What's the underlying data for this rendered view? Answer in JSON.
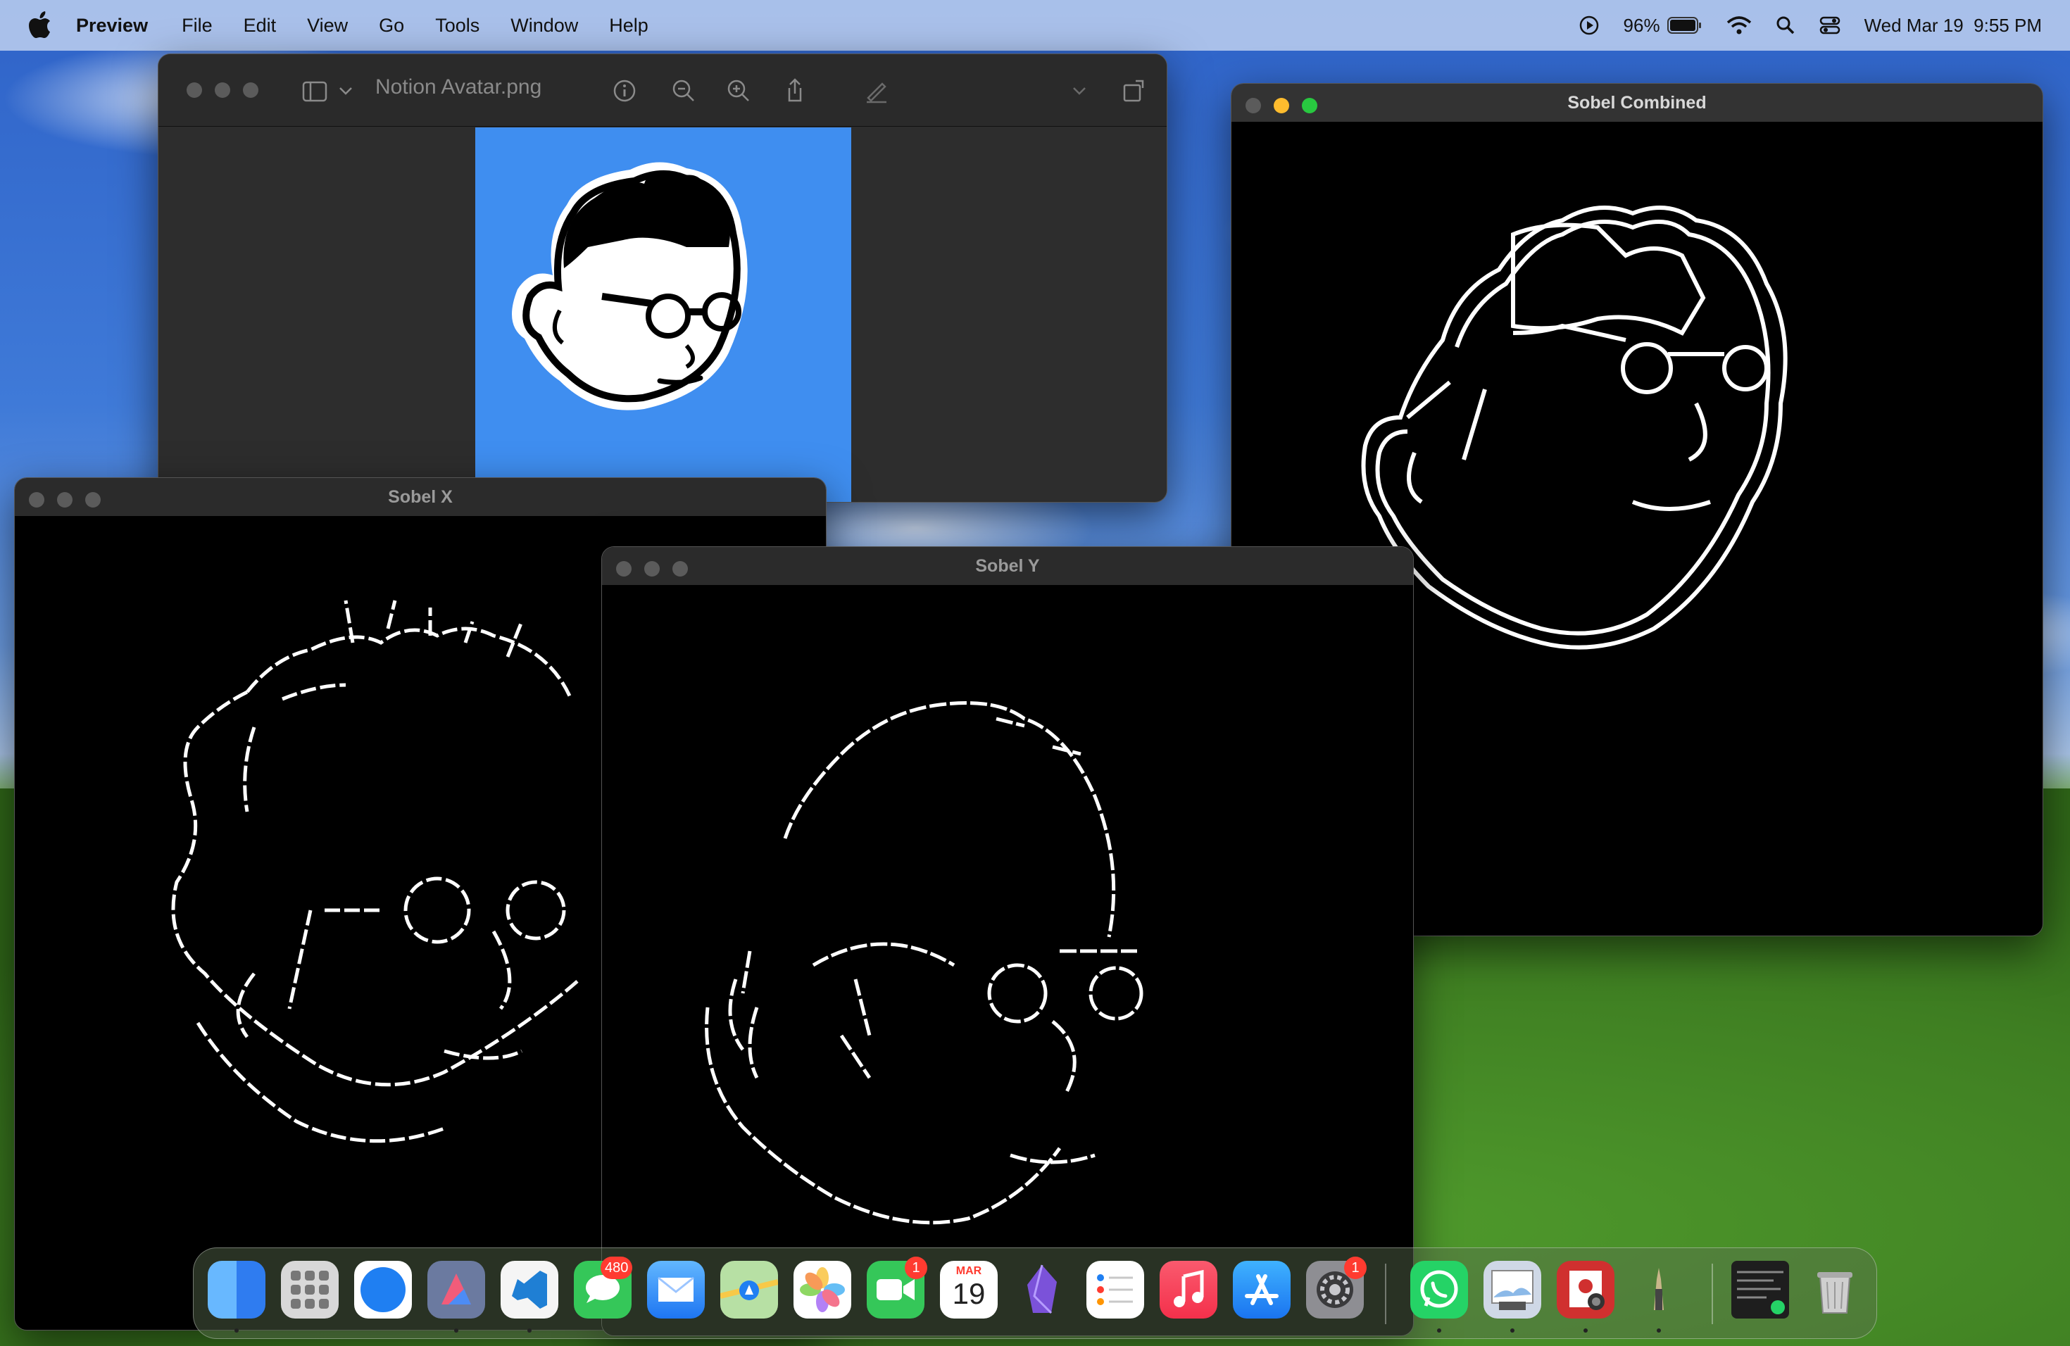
{
  "menubar": {
    "app_name": "Preview",
    "items": [
      "File",
      "Edit",
      "View",
      "Go",
      "Tools",
      "Window",
      "Help"
    ],
    "battery": "96%",
    "datetime": "Wed Mar 19  9:55 PM",
    "icons": [
      "apple-icon",
      "play-icon",
      "battery-icon",
      "wifi-icon",
      "search-icon",
      "control-center-icon"
    ]
  },
  "preview_window": {
    "title": "Notion Avatar.png",
    "toolbar_icons": [
      "sidebar-icon",
      "chevron-down-icon",
      "info-icon",
      "zoom-out-icon",
      "zoom-in-icon",
      "share-icon",
      "markup-pen-icon",
      "chevron-down-icon",
      "rotate-icon",
      "markup-icon",
      "more-icon",
      "search-icon"
    ]
  },
  "windows": {
    "sobel_x": {
      "title": "Sobel X"
    },
    "sobel_y": {
      "title": "Sobel Y"
    },
    "sobel_combined": {
      "title": "Sobel Combined"
    }
  },
  "dock": {
    "apps": [
      {
        "name": "Finder",
        "color": "#3a8ef6"
      },
      {
        "name": "Launchpad",
        "color": "#d8d8d8"
      },
      {
        "name": "Safari",
        "color": "#1f7ff2"
      },
      {
        "name": "Affinity Designer",
        "color": "#7c89a8"
      },
      {
        "name": "Visual Studio Code",
        "color": "#f5f5f5"
      },
      {
        "name": "Messages",
        "color": "#35c759",
        "badge": "480"
      },
      {
        "name": "Mail",
        "color": "#2f8bf5"
      },
      {
        "name": "Maps",
        "color": "#7cc576"
      },
      {
        "name": "Photos",
        "color": "#ffffff"
      },
      {
        "name": "FaceTime",
        "color": "#35c759",
        "badge": "1"
      },
      {
        "name": "Calendar",
        "color": "#ffffff",
        "month": "MAR",
        "day": "19"
      },
      {
        "name": "Obsidian",
        "color": "#2b2140"
      },
      {
        "name": "Reminders",
        "color": "#ffffff"
      },
      {
        "name": "Music",
        "color": "#fa3b53"
      },
      {
        "name": "App Store",
        "color": "#1c8af5"
      },
      {
        "name": "System Settings",
        "color": "#8e8e93",
        "badge": "1"
      },
      {
        "name": "WhatsApp",
        "color": "#25d366"
      },
      {
        "name": "Preview",
        "color": "#cfd8e6"
      },
      {
        "name": "Photo Booth",
        "color": "#d0302f"
      },
      {
        "name": "Pen",
        "color": "#c9b68a"
      },
      {
        "name": "Terminal Window",
        "color": "#1e1e1e"
      },
      {
        "name": "Trash",
        "color": "#c8c8c8"
      }
    ]
  }
}
